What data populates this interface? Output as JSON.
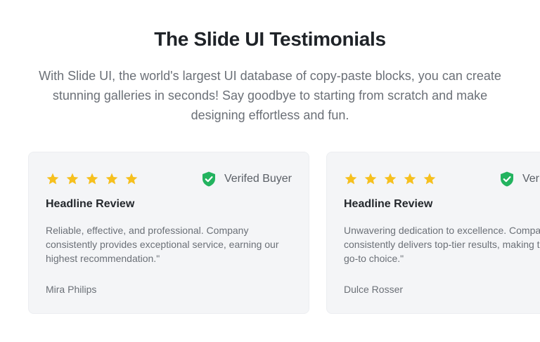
{
  "header": {
    "title": "The Slide UI Testimonials",
    "subtitle": "With Slide UI, the world's largest UI database of copy-paste blocks, you can create stunning galleries in seconds! Say goodbye to starting from scratch and make designing effortless and fun."
  },
  "colors": {
    "star": "#f6c01e",
    "verified": "#23b35f"
  },
  "testimonials": [
    {
      "rating": 5,
      "verified_label": "Verifed Buyer",
      "headline": "Headline Review",
      "text": "Reliable, effective, and professional. Company consistently provides exceptional service, earning our highest recommendation.\"",
      "author": "Mira Philips"
    },
    {
      "rating": 5,
      "verified_label": "Verifed Buyer",
      "headline": "Headline Review",
      "text": "Unwavering dedication to excellence. Company consistently delivers top-tier results, making them our go-to choice.\"",
      "author": "Dulce Rosser"
    }
  ]
}
